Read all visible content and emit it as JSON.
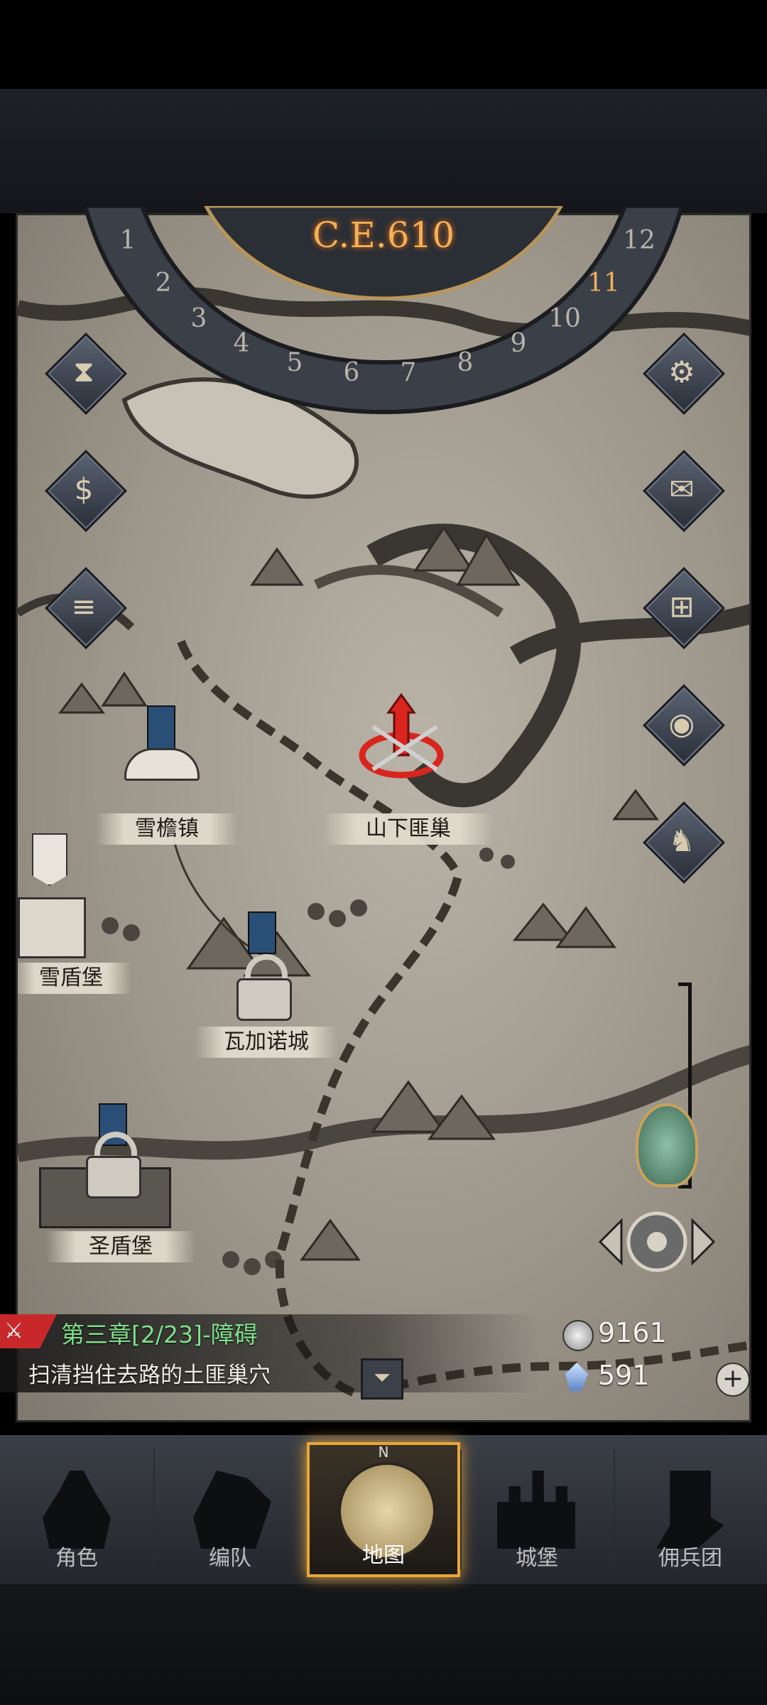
{
  "calendar": {
    "year": "C.E.610",
    "months": [
      "1",
      "2",
      "3",
      "4",
      "5",
      "6",
      "7",
      "8",
      "9",
      "10",
      "11",
      "12"
    ],
    "current_month": "11"
  },
  "left_buttons": [
    {
      "icon": "hourglass-icon"
    },
    {
      "icon": "money-bag-icon"
    },
    {
      "icon": "scroll-icon"
    }
  ],
  "right_buttons": [
    {
      "icon": "gear-icon"
    },
    {
      "icon": "mail-icon"
    },
    {
      "icon": "window-icon"
    },
    {
      "icon": "coin-icon"
    },
    {
      "icon": "merchant-icon"
    }
  ],
  "locations": [
    {
      "name": "雪檐镇",
      "status": "unlocked"
    },
    {
      "name": "山下匪巢",
      "status": "target"
    },
    {
      "name": "雪盾堡",
      "status": "unlocked"
    },
    {
      "name": "瓦加诺城",
      "status": "locked"
    },
    {
      "name": "圣盾堡",
      "status": "locked"
    }
  ],
  "quest": {
    "chapter": "第三章[2/23]-障碍",
    "description": "扫清挡住去路的土匪巢穴"
  },
  "resources": {
    "silver": "9161",
    "crystal": "591"
  },
  "nav": {
    "items": [
      {
        "label": "角色"
      },
      {
        "label": "编队"
      },
      {
        "label": "地图",
        "active": true
      },
      {
        "label": "城堡"
      },
      {
        "label": "佣兵团"
      }
    ],
    "compass_label": "N"
  },
  "colors": {
    "accent": "#e8a63a",
    "quest_green": "#7ee08a",
    "target_red": "#d8261f"
  }
}
